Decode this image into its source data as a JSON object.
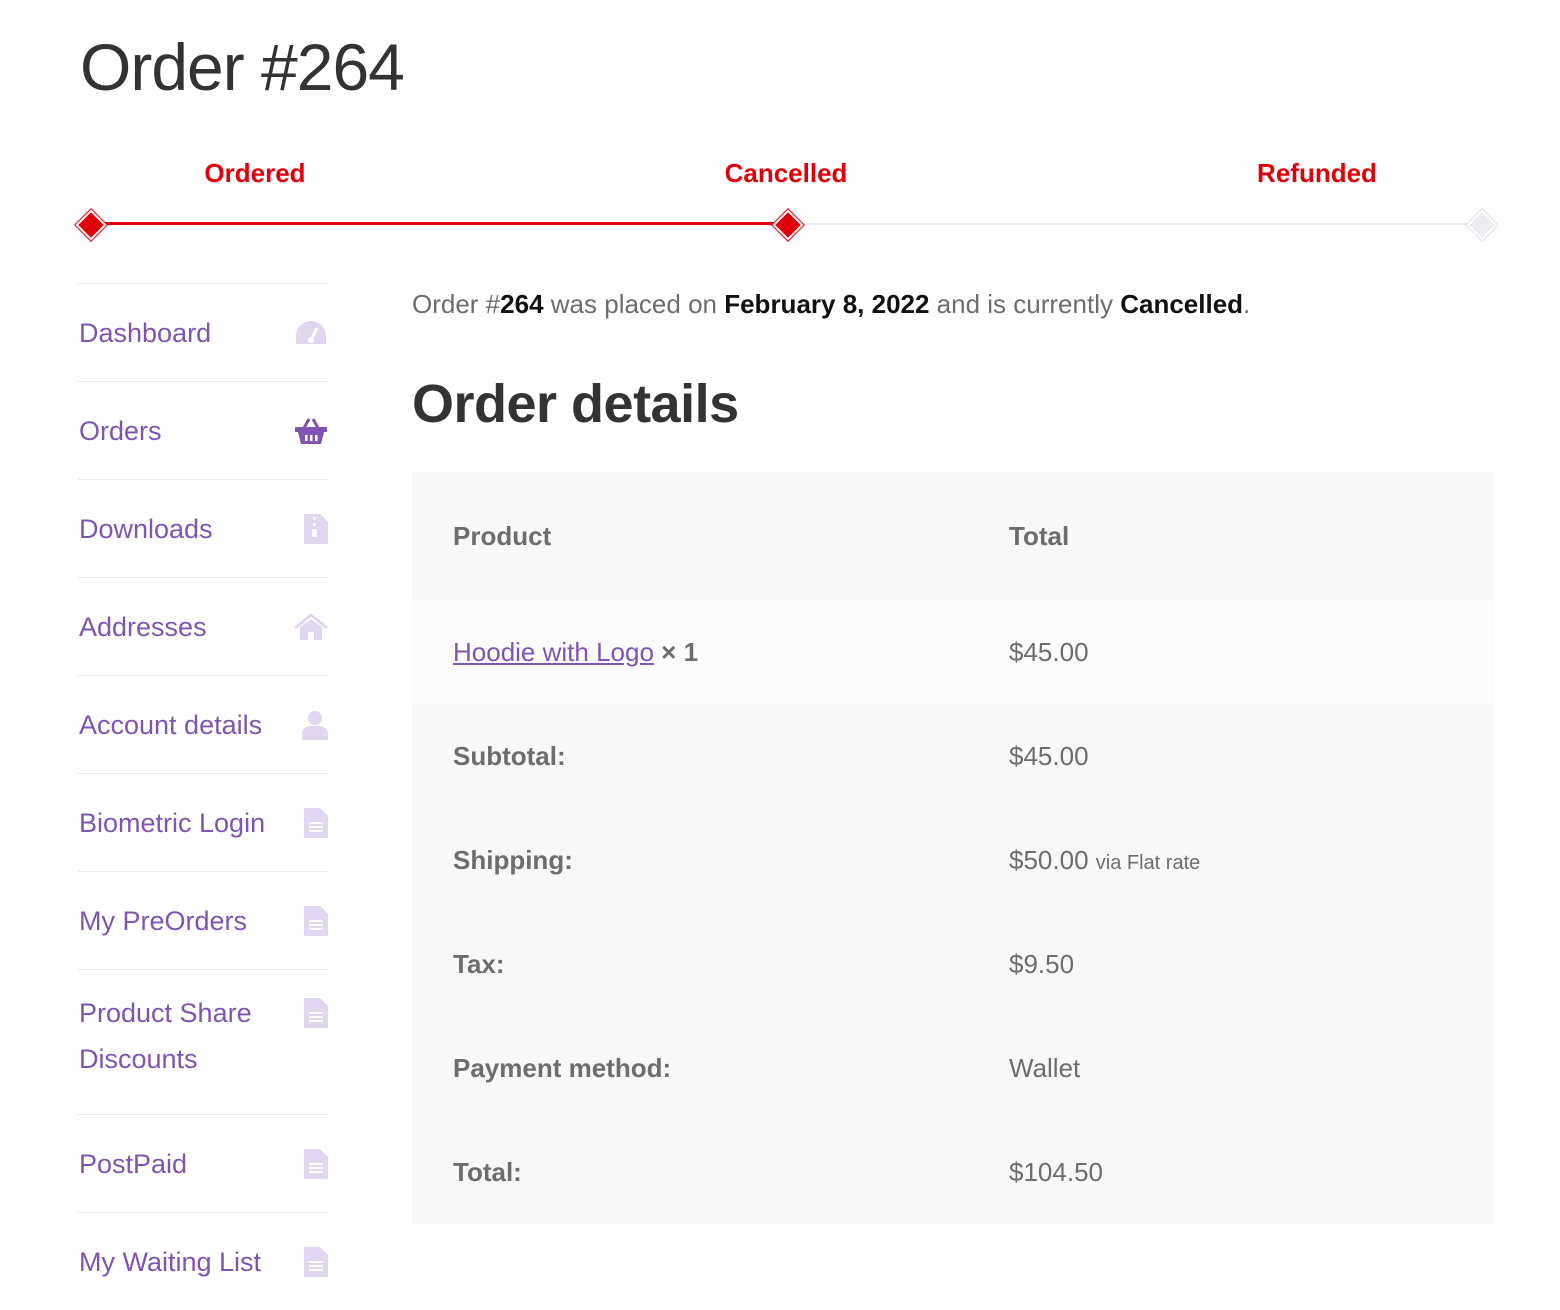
{
  "page": {
    "title": "Order #264"
  },
  "tracker": {
    "steps": [
      {
        "label": "Ordered",
        "state": "done"
      },
      {
        "label": "Cancelled",
        "state": "done"
      },
      {
        "label": "Refunded",
        "state": "pending"
      }
    ],
    "colors": {
      "active": "#e0000a",
      "inactive": "#e6e6ee"
    }
  },
  "nav": {
    "items": [
      {
        "label": "Dashboard",
        "icon": "dashboard-gauge-icon"
      },
      {
        "label": "Orders",
        "icon": "shopping-basket-icon",
        "active": true
      },
      {
        "label": "Downloads",
        "icon": "file-archive-icon"
      },
      {
        "label": "Addresses",
        "icon": "home-icon"
      },
      {
        "label": "Account details",
        "icon": "user-icon"
      },
      {
        "label": "Biometric Login",
        "icon": "file-text-icon"
      },
      {
        "label": "My PreOrders",
        "icon": "file-text-icon"
      },
      {
        "label": "Product Share Discounts",
        "icon": "file-text-icon"
      },
      {
        "label": "PostPaid",
        "icon": "file-text-icon"
      },
      {
        "label": "My Waiting List",
        "icon": "file-text-icon"
      }
    ],
    "colors": {
      "link": "#7f54b3",
      "icon": "#e1d6ef",
      "active_icon": "#7f54b3"
    }
  },
  "summary": {
    "prefix": "Order #",
    "order_number": "264",
    "placed_text": " was placed on ",
    "date": "February 8, 2022",
    "status_text": " and is currently ",
    "status": "Cancelled",
    "suffix": "."
  },
  "details": {
    "title": "Order details",
    "headers": {
      "product": "Product",
      "total": "Total"
    },
    "item": {
      "name": "Hoodie with Logo",
      "qty": "× 1",
      "total": "$45.00"
    },
    "totals": [
      {
        "label": "Subtotal:",
        "value": "$45.00",
        "note": ""
      },
      {
        "label": "Shipping:",
        "value": "$50.00",
        "note": "via Flat rate"
      },
      {
        "label": "Tax:",
        "value": "$9.50",
        "note": ""
      },
      {
        "label": "Payment method:",
        "value": "Wallet",
        "note": ""
      },
      {
        "label": "Total:",
        "value": "$104.50",
        "note": ""
      }
    ]
  }
}
